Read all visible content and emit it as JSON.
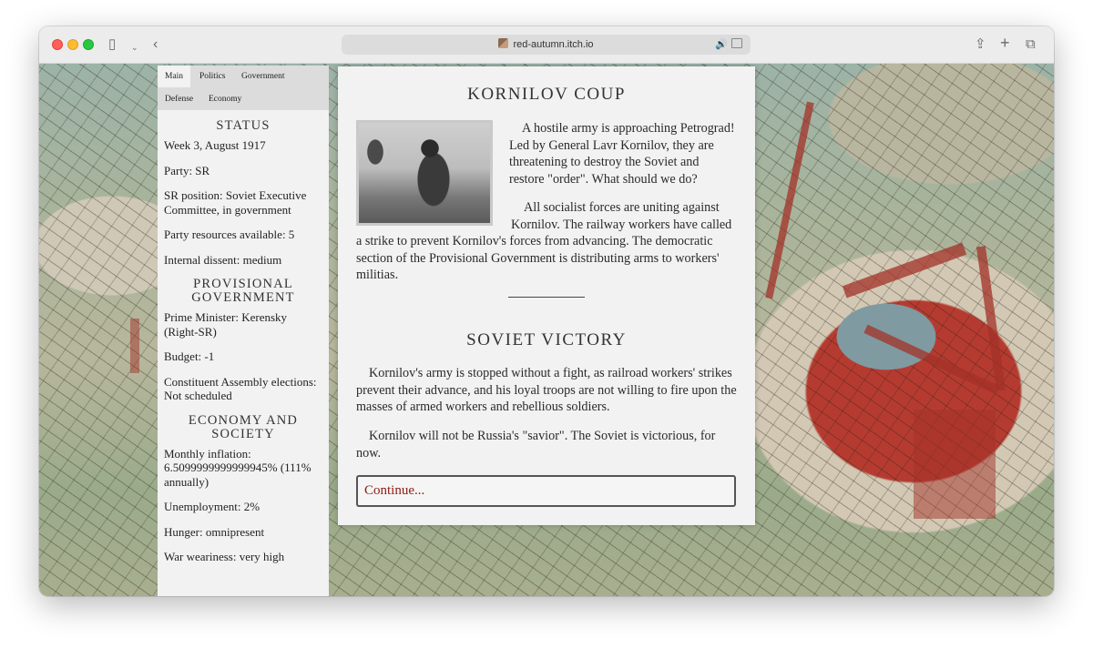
{
  "browser": {
    "url": "red-autumn.itch.io"
  },
  "sidebar": {
    "tabs": [
      "Main",
      "Politics",
      "Government",
      "Defense",
      "Economy"
    ],
    "active_tab": "Main",
    "status": {
      "heading": "STATUS",
      "week": "Week 3, August 1917",
      "party": "Party: SR",
      "position": "SR position: Soviet Executive Committee, in government",
      "resources": "Party resources available: 5",
      "dissent": "Internal dissent: medium"
    },
    "provisional": {
      "heading": "PROVISIONAL GOVERNMENT",
      "pm": "Prime Minister: Kerensky (Right-SR)",
      "budget": "Budget: -1",
      "assembly": "Constituent Assembly elections: Not scheduled"
    },
    "economy": {
      "heading": "ECONOMY AND SOCIETY",
      "inflation": "Monthly inflation: 6.5099999999999945% (111% annually)",
      "unemployment": "Unemployment: 2%",
      "hunger": "Hunger: omnipresent",
      "war": "War weariness: very high"
    }
  },
  "story": {
    "title1": "KORNILOV COUP",
    "para1": "A hostile army is approaching Petrograd! Led by General Lavr Kornilov, they are threatening to destroy the Soviet and restore \"order\". What should we do?",
    "para2": "All socialist forces are uniting against Kornilov. The railway workers have called a strike to prevent Kornilov's forces from advancing. The democratic section of the Provisional Government is distributing arms to workers' militias.",
    "title2": "SOVIET VICTORY",
    "para3": "Kornilov's army is stopped without a fight, as railroad workers' strikes prevent their advance, and his loyal troops are not willing to fire upon the masses of armed workers and rebellious soldiers.",
    "para4": "Kornilov will not be Russia's \"savior\". The Soviet is victorious, for now.",
    "continue": "Continue..."
  }
}
